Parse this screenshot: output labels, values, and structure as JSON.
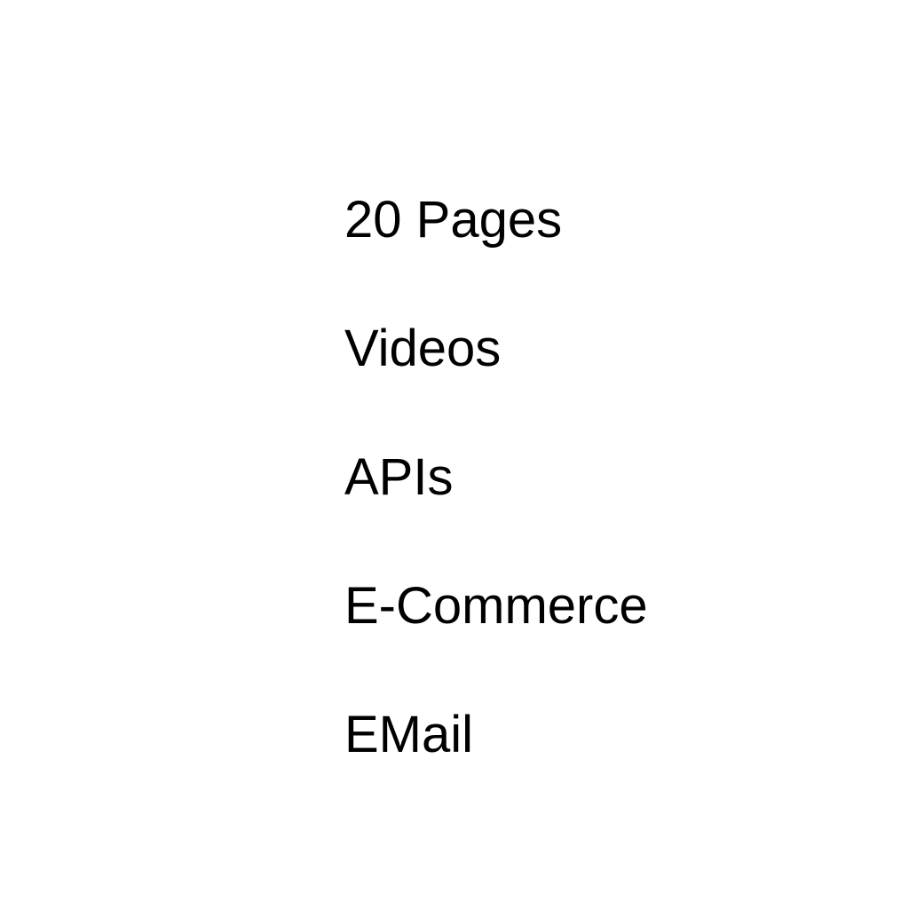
{
  "features": {
    "items": [
      {
        "label": "20 Pages"
      },
      {
        "label": "Videos"
      },
      {
        "label": "APIs"
      },
      {
        "label": "E-Commerce"
      },
      {
        "label": "EMail"
      }
    ]
  }
}
